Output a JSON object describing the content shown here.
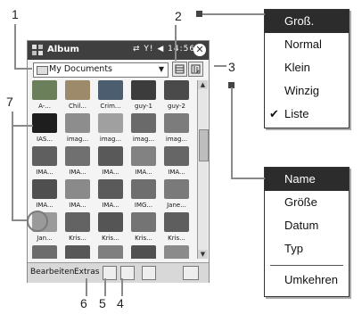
{
  "window": {
    "title": "Album",
    "status": "⇄ Y! ◀ 14:56",
    "close_label": "✕"
  },
  "folder": {
    "label": "My Documents",
    "dropdown": "▼"
  },
  "menubar": {
    "edit": "Bearbeiten",
    "extras": "Extras"
  },
  "callouts": [
    "1",
    "2",
    "3",
    "4",
    "5",
    "6",
    "7"
  ],
  "view_menu": {
    "items": [
      {
        "label": "Groß.",
        "selected": true,
        "checked": false
      },
      {
        "label": "Normal",
        "selected": false,
        "checked": false
      },
      {
        "label": "Klein",
        "selected": false,
        "checked": false
      },
      {
        "label": "Winzig",
        "selected": false,
        "checked": false
      },
      {
        "label": "Liste",
        "selected": false,
        "checked": true
      }
    ]
  },
  "sort_menu": {
    "items": [
      {
        "label": "Name",
        "selected": true
      },
      {
        "label": "Größe",
        "selected": false
      },
      {
        "label": "Datum",
        "selected": false
      },
      {
        "label": "Typ",
        "selected": false
      }
    ],
    "reverse": "Umkehren"
  },
  "thumbnails": [
    {
      "caption": "A-...",
      "color": "#6b7f5a"
    },
    {
      "caption": "Chil...",
      "color": "#9c8a6a"
    },
    {
      "caption": "Crim...",
      "color": "#4d5d70"
    },
    {
      "caption": "guy-1",
      "color": "#3c3c3c"
    },
    {
      "caption": "guy-2",
      "color": "#4a4a4a"
    },
    {
      "caption": "IAS...",
      "color": "#1e1e1e"
    },
    {
      "caption": "imag...",
      "color": "#8d8d8d"
    },
    {
      "caption": "imag...",
      "color": "#a0a0a0"
    },
    {
      "caption": "imag...",
      "color": "#6a6a6a"
    },
    {
      "caption": "imag...",
      "color": "#7c7c7c"
    },
    {
      "caption": "IMA...",
      "color": "#5f5f5f"
    },
    {
      "caption": "IMA...",
      "color": "#707070"
    },
    {
      "caption": "IMA...",
      "color": "#595959"
    },
    {
      "caption": "IMA...",
      "color": "#828282"
    },
    {
      "caption": "IMA...",
      "color": "#666666"
    },
    {
      "caption": "IMA...",
      "color": "#4f4f4f"
    },
    {
      "caption": "IMA...",
      "color": "#8a8a8a"
    },
    {
      "caption": "IMA...",
      "color": "#5a5a5a"
    },
    {
      "caption": "IMG...",
      "color": "#6e6e6e"
    },
    {
      "caption": "Jane...",
      "color": "#7a7a7a"
    },
    {
      "caption": "Jan...",
      "color": "#9a9a9a"
    },
    {
      "caption": "Kris...",
      "color": "#636363"
    },
    {
      "caption": "Kris...",
      "color": "#555555"
    },
    {
      "caption": "Kris...",
      "color": "#747474"
    },
    {
      "caption": "Kris...",
      "color": "#5e5e5e"
    },
    {
      "caption": "",
      "color": "#6c6c6c"
    },
    {
      "caption": "",
      "color": "#575757"
    },
    {
      "caption": "",
      "color": "#7f7f7f"
    },
    {
      "caption": "",
      "color": "#515151"
    },
    {
      "caption": "",
      "color": "#8b8b8b"
    }
  ]
}
